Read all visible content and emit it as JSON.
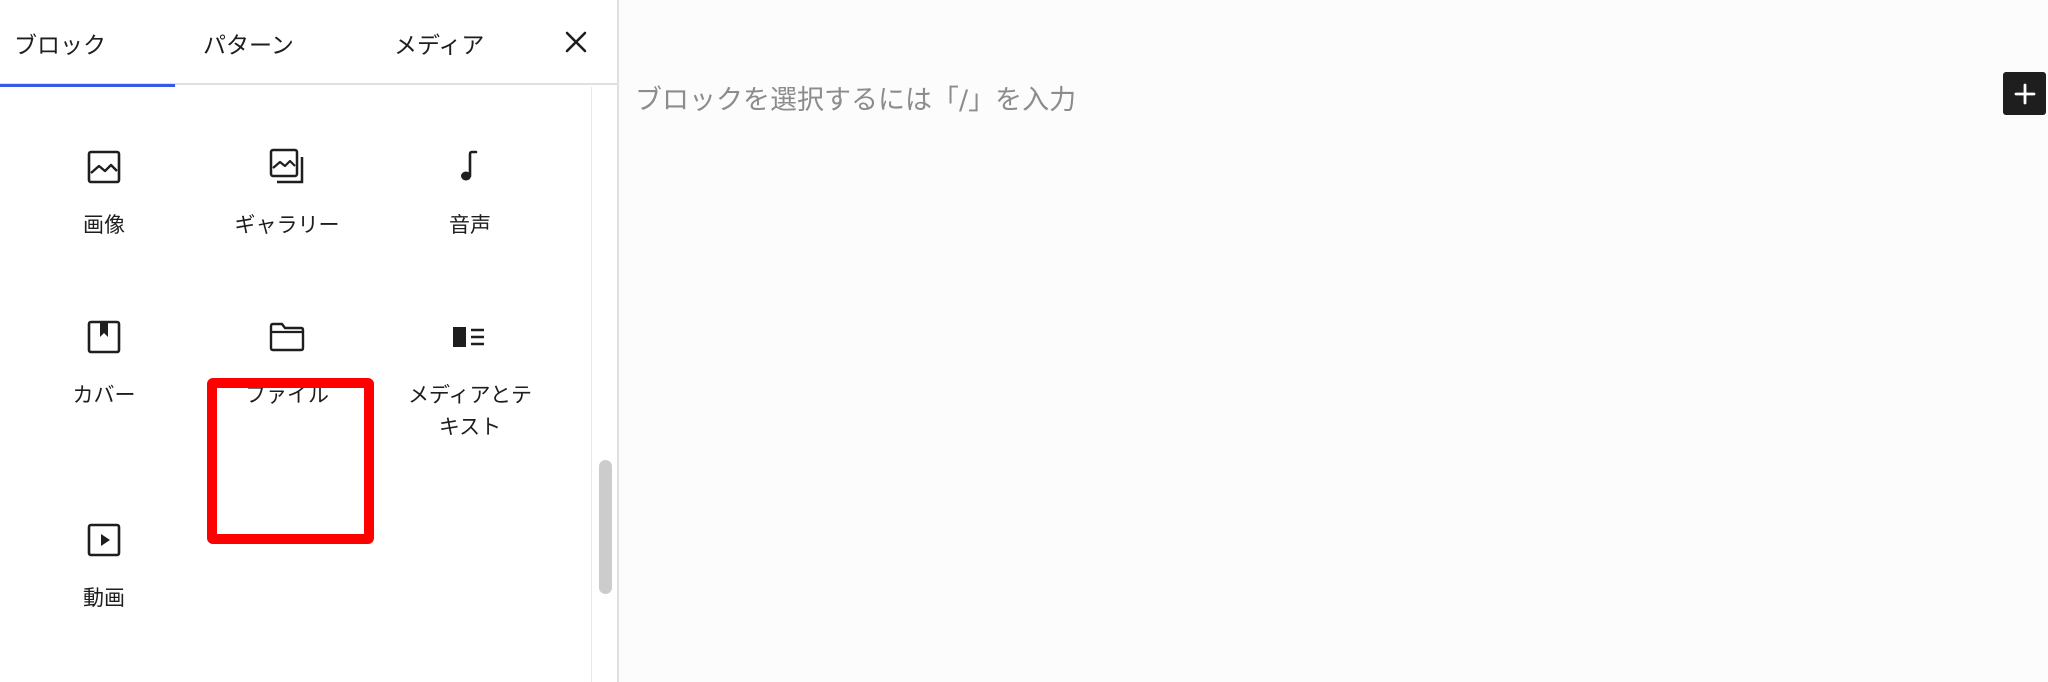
{
  "inserter": {
    "tabs": [
      {
        "label": "ブロック",
        "active": true
      },
      {
        "label": "パターン",
        "active": false
      },
      {
        "label": "メディア",
        "active": false
      }
    ],
    "close_icon": "close-icon",
    "blocks": [
      {
        "label": "画像",
        "icon": "image-icon"
      },
      {
        "label": "ギャラリー",
        "icon": "gallery-icon"
      },
      {
        "label": "音声",
        "icon": "audio-icon"
      },
      {
        "label": "カバー",
        "icon": "cover-icon"
      },
      {
        "label": "ファイル",
        "icon": "folder-icon",
        "highlighted": true
      },
      {
        "label": "メディアとテキスト",
        "icon": "media-text-icon"
      },
      {
        "label": "動画",
        "icon": "video-icon"
      }
    ],
    "highlight_color": "#ff0000",
    "accent_color": "#3858e9"
  },
  "editor": {
    "placeholder": "ブロックを選択するには「/」を入力",
    "add_block_icon": "plus-icon"
  }
}
